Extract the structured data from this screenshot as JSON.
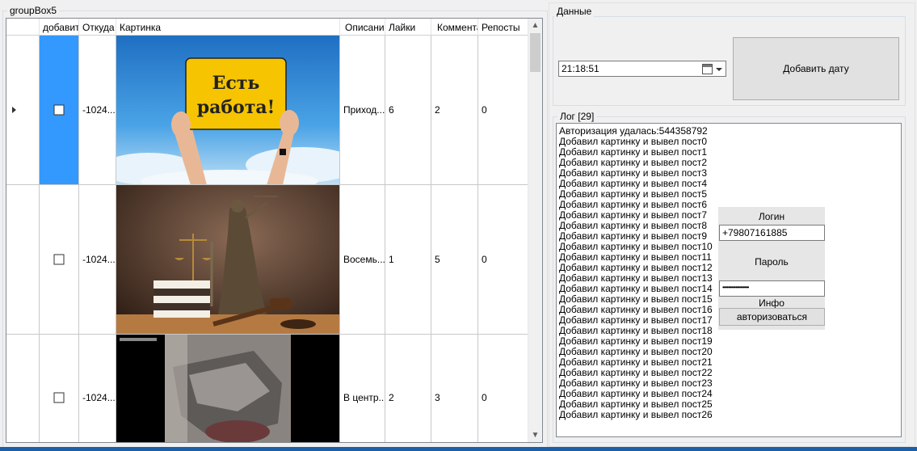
{
  "groupbox_main": {
    "title": "groupBox5"
  },
  "grid": {
    "columns": [
      "добавит",
      "Откуда",
      "Картинка",
      "Описание",
      "Лайки",
      "Коммента",
      "Репосты"
    ],
    "rows": [
      {
        "from": "-1024...",
        "desc": "Приход...",
        "likes": "6",
        "comments": "2",
        "reposts": "0",
        "image": "est-rabota-sign"
      },
      {
        "from": "-1024...",
        "desc": "Восемь...",
        "likes": "1",
        "comments": "5",
        "reposts": "0",
        "image": "themis-statue"
      },
      {
        "from": "-1024...",
        "desc": "В центр...",
        "likes": "2",
        "comments": "3",
        "reposts": "0",
        "image": "car-crash-video"
      }
    ],
    "image1_text": "Есть работа!"
  },
  "data_group": {
    "title": "Данные",
    "time_value": "21:18:51",
    "add_date_label": "Добавить дату"
  },
  "log_group": {
    "title": "Лог [29]",
    "lines": [
      "Авторизация удалась:544358792",
      "Добавил картинку и вывел пост0",
      "Добавил картинку и вывел пост1",
      "Добавил картинку и вывел пост2",
      "Добавил картинку и вывел пост3",
      "Добавил картинку и вывел пост4",
      "Добавил картинку и вывел пост5",
      "Добавил картинку и вывел пост6",
      "Добавил картинку и вывел пост7",
      "Добавил картинку и вывел пост8",
      "Добавил картинку и вывел пост9",
      "Добавил картинку и вывел пост10",
      "Добавил картинку и вывел пост11",
      "Добавил картинку и вывел пост12",
      "Добавил картинку и вывел пост13",
      "Добавил картинку и вывел пост14",
      "Добавил картинку и вывел пост15",
      "Добавил картинку и вывел пост16",
      "Добавил картинку и вывел пост17",
      "Добавил картинку и вывел пост18",
      "Добавил картинку и вывел пост19",
      "Добавил картинку и вывел пост20",
      "Добавил картинку и вывел пост21",
      "Добавил картинку и вывел пост22",
      "Добавил картинку и вывел пост23",
      "Добавил картинку и вывел пост24",
      "Добавил картинку и вывел пост25",
      "Добавил картинку и вывел пост26"
    ]
  },
  "auth": {
    "login_label": "Логин",
    "login_value": "+79807161885",
    "password_label": "Пароль",
    "password_value": "••••••••••••••••••",
    "info_label": "Инфо",
    "auth_button": "авторизоваться"
  },
  "colors": {
    "selection": "#3399ff",
    "window_bg": "#f0f0f0",
    "bottom_bar": "#1b5fa8"
  }
}
